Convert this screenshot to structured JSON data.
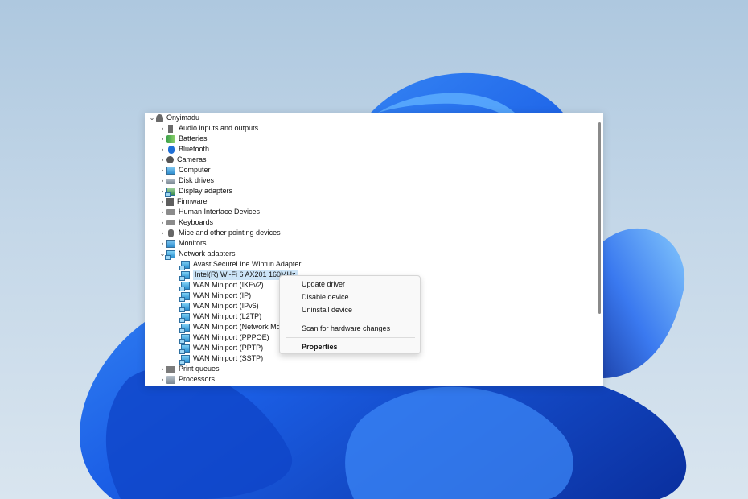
{
  "tree": {
    "root": "Onyimadu",
    "categories": [
      "Audio inputs and outputs",
      "Batteries",
      "Bluetooth",
      "Cameras",
      "Computer",
      "Disk drives",
      "Display adapters",
      "Firmware",
      "Human Interface Devices",
      "Keyboards",
      "Mice and other pointing devices",
      "Monitors",
      "Network adapters",
      "Print queues",
      "Processors"
    ],
    "network_adapters": [
      "Avast SecureLine Wintun Adapter",
      "Intel(R) Wi-Fi 6 AX201 160MHz",
      "WAN Miniport (IKEv2)",
      "WAN Miniport (IP)",
      "WAN Miniport (IPv6)",
      "WAN Miniport (L2TP)",
      "WAN Miniport (Network Monitor)",
      "WAN Miniport (PPPOE)",
      "WAN Miniport (PPTP)",
      "WAN Miniport (SSTP)"
    ]
  },
  "context_menu": {
    "update_driver": "Update driver",
    "disable_device": "Disable device",
    "uninstall_device": "Uninstall device",
    "scan_hardware": "Scan for hardware changes",
    "properties": "Properties"
  },
  "colors": {
    "selection": "#cce4f7",
    "wallpaper_bloom": "#1a5fe0"
  }
}
